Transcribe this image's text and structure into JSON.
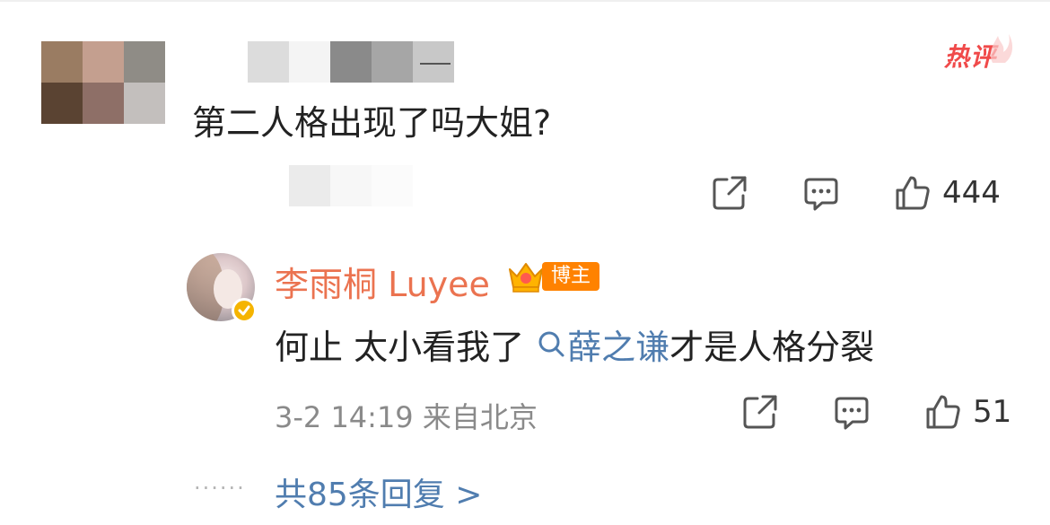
{
  "comment": {
    "text": "第二人格出现了吗大姐?",
    "badge": "热评",
    "actions": {
      "share_icon": "share-icon",
      "comment_icon": "comment-icon",
      "like_icon": "thumbs-up-icon",
      "like_count": "444"
    }
  },
  "reply": {
    "author": "李雨桐 Luyee",
    "tag": "博主",
    "text_before": "何止 太小看我了",
    "topic": "薛之谦",
    "text_after": "才是人格分裂",
    "meta": "3-2 14:19 来自北京",
    "actions": {
      "like_count": "51"
    }
  },
  "more_replies": "共85条回复 >",
  "colors": {
    "accent_link": "#507daf",
    "author_name": "#eb7350",
    "hot_red": "#f04a4a",
    "blogger_orange": "#ff8200"
  }
}
